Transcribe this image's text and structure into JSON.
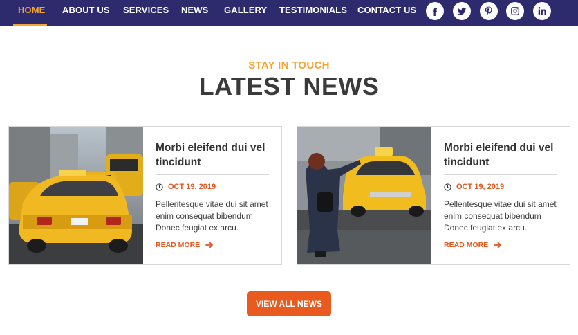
{
  "nav": {
    "items": [
      {
        "label": "HOME",
        "active": true
      },
      {
        "label": "ABOUT US"
      },
      {
        "label": "SERVICES"
      },
      {
        "label": "NEWS"
      },
      {
        "label": "GALLERY"
      },
      {
        "label": "TESTIMONIALS"
      },
      {
        "label": "CONTACT US"
      }
    ],
    "social": [
      "facebook-icon",
      "twitter-icon",
      "pinterest-icon",
      "instagram-icon",
      "linkedin-icon"
    ]
  },
  "section": {
    "kicker": "STAY IN TOUCH",
    "title": "LATEST NEWS"
  },
  "cards": [
    {
      "title": "Morbi eleifend dui vel tincidunt",
      "date": "OCT 19, 2019",
      "excerpt": "Pellentesque vitae dui sit amet enim consequat bibendum Donec feugiat ex arcu.",
      "read_more": "READ MORE"
    },
    {
      "title": "Morbi eleifend dui vel tincidunt",
      "date": "OCT 19, 2019",
      "excerpt": "Pellentesque vitae dui sit amet enim consequat bibendum Donec feugiat ex arcu.",
      "read_more": "READ MORE"
    }
  ],
  "button": {
    "label": "VIEW ALL NEWS"
  },
  "colors": {
    "nav_bg": "#2e2a6e",
    "accent": "#f4a534",
    "orange": "#e85a1e"
  }
}
